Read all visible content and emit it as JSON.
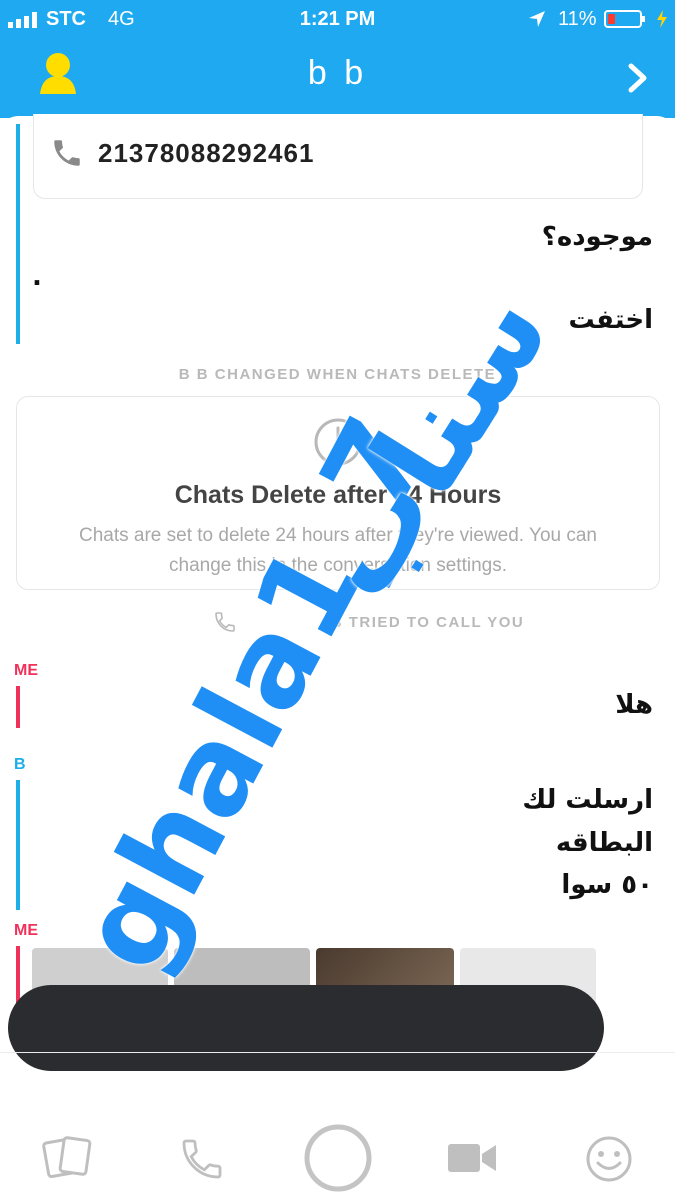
{
  "status_bar": {
    "carrier": "STC",
    "network": "4G",
    "time": "1:21 PM",
    "battery": "11%"
  },
  "header": {
    "title": "b b"
  },
  "contact_card": {
    "phone": "21378088292461"
  },
  "messages_top": [
    {
      "text": "موجوده؟"
    },
    {
      "text": "."
    },
    {
      "text": "اختفت"
    }
  ],
  "system_changed": "B B CHANGED WHEN CHATS DELETE",
  "info_card": {
    "title": "Chats Delete after 24 Hours",
    "body": "Chats are set to delete 24 hours after they're viewed. You can change this in the conversation settings."
  },
  "system_call": "B TRIED TO CALL YOU",
  "senders": {
    "me": "ME",
    "b": "B",
    "me2": "ME"
  },
  "message_me": "هلا",
  "message_b": [
    "ارسلت لك",
    "البطاقه",
    "٥٠ سوا"
  ],
  "watermark": {
    "latin": "ghala1_7",
    "arabic": "سناب"
  },
  "colors": {
    "accent": "#1ea9f0",
    "me": "#f0325a",
    "b": "#1eaee8"
  },
  "nav_icons": [
    "cards-icon",
    "phone-icon",
    "capture-icon",
    "video-icon",
    "smiley-icon"
  ]
}
